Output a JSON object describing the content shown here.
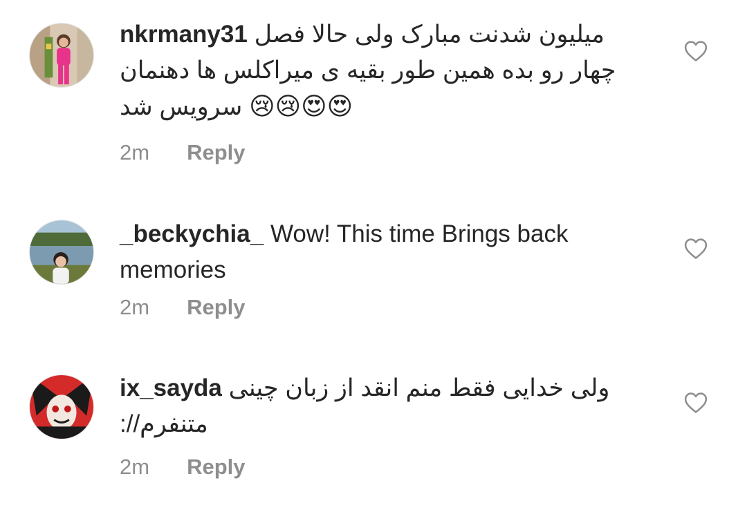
{
  "comments": [
    {
      "username": "nkrmany31",
      "line1": "میلیون شدنت مبارک ولی حالا فصل",
      "line2": "چهار رو بده همین طور بقیه ی میراکلس ها دهنمان",
      "line3_text": "سرویس شد",
      "line3_emoji": "😢😢😍😍",
      "time": "2m",
      "reply": "Reply",
      "like_icon": "heart-outline-icon"
    },
    {
      "username": "_beckychia_",
      "line1": "Wow! This time Brings back",
      "line2": "memories",
      "time": "2m",
      "reply": "Reply",
      "like_icon": "heart-outline-icon"
    },
    {
      "username": "ix_sayda",
      "line1": "ولی خدایی فقط منم انقد از زبان چینی",
      "line2": "متنفرم//:",
      "time": "2m",
      "reply": "Reply",
      "like_icon": "heart-outline-icon"
    }
  ],
  "colors": {
    "text": "#262626",
    "muted": "#8e8e8e",
    "background": "#ffffff"
  }
}
